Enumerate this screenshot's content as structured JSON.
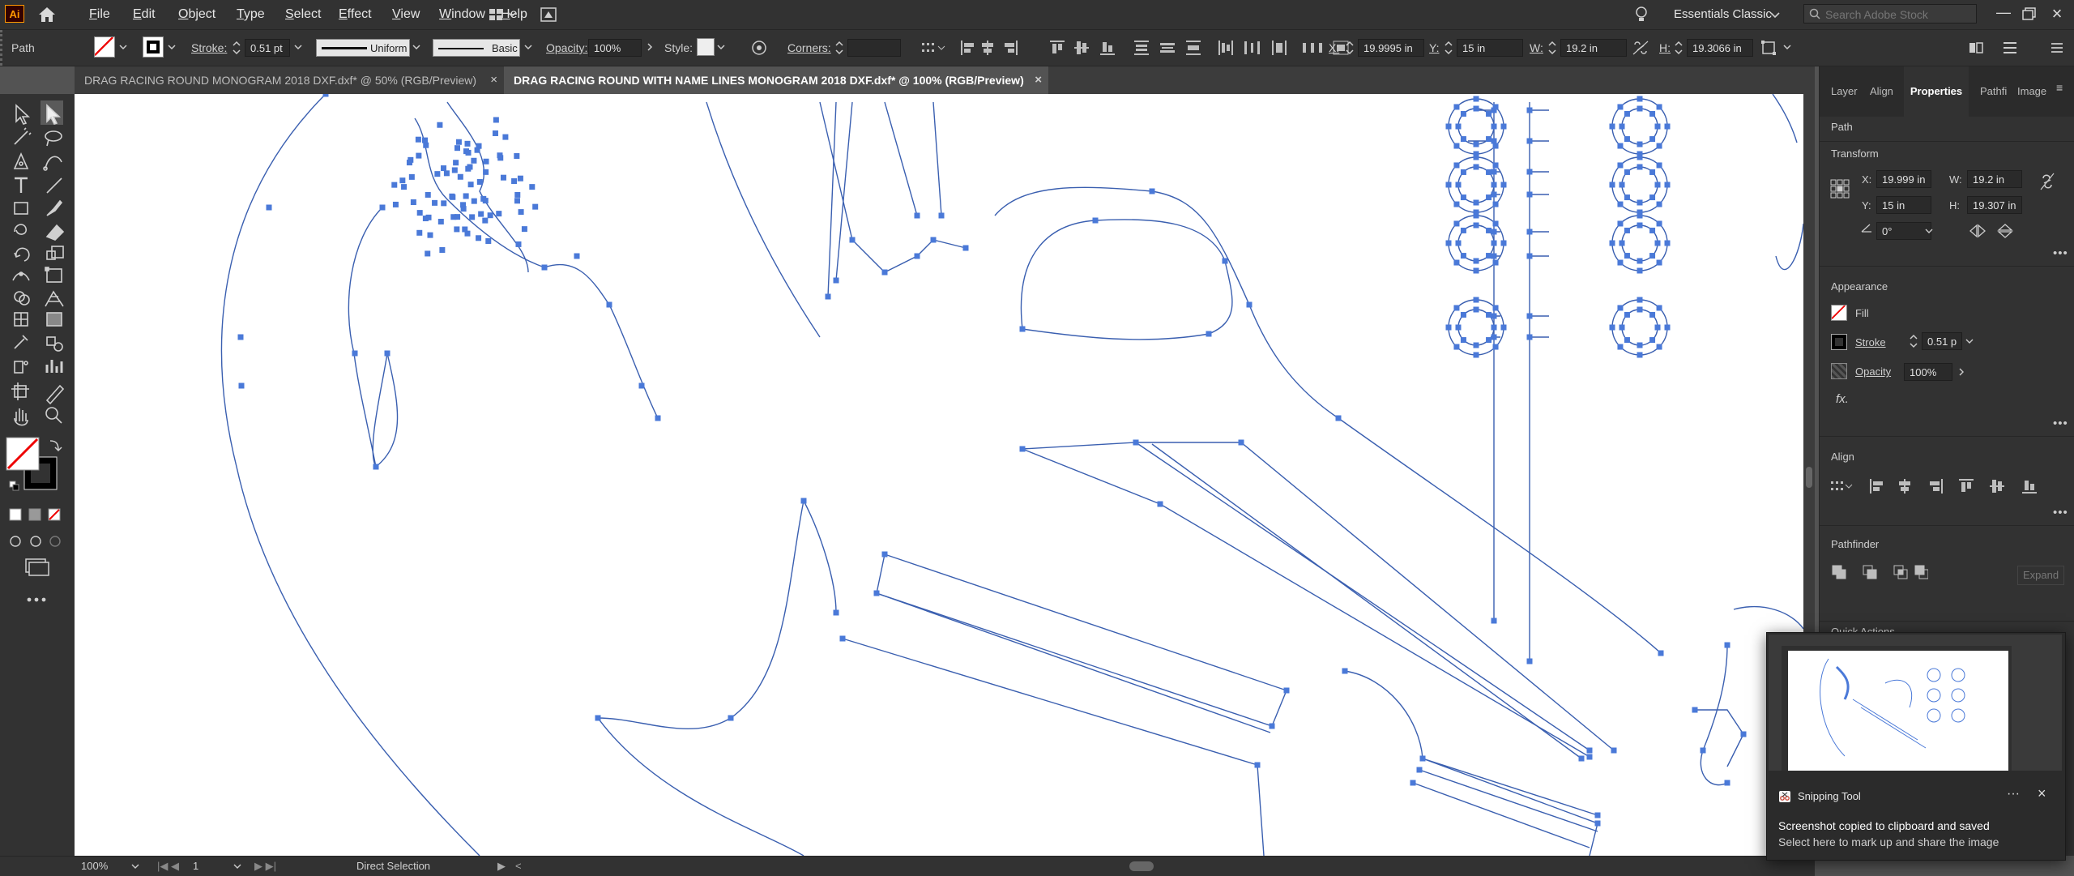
{
  "app": {
    "logo": "Ai"
  },
  "menu": {
    "items": [
      {
        "label": "File",
        "u": "F",
        "rest": "ile"
      },
      {
        "label": "Edit",
        "u": "E",
        "rest": "dit"
      },
      {
        "label": "Object",
        "u": "O",
        "rest": "bject"
      },
      {
        "label": "Type",
        "u": "T",
        "rest": "ype"
      },
      {
        "label": "Select",
        "u": "S",
        "rest": "elect"
      },
      {
        "label": "Effect",
        "u": "E",
        "rest": "ffect"
      },
      {
        "label": "View",
        "u": "V",
        "rest": "iew"
      },
      {
        "label": "Window",
        "u": "W",
        "rest": "indow"
      },
      {
        "label": "Help",
        "u": "H",
        "rest": "elp"
      }
    ],
    "workspace": "Essentials Classic",
    "search_placeholder": "Search Adobe Stock"
  },
  "control": {
    "object_type": "Path",
    "stroke_label": "Stroke:",
    "stroke_value": "0.51 pt",
    "profile_uniform": "Uniform",
    "brush_basic": "Basic",
    "opacity_label": "Opacity:",
    "opacity_value": "100%",
    "style_label": "Style:",
    "corners_label": "Corners:",
    "x_label": "X:",
    "x_value": "19.9995 in",
    "y_label": "Y:",
    "y_value": "15 in",
    "w_label": "W:",
    "w_value": "19.2 in",
    "h_label": "H:",
    "h_value": "19.3066 in"
  },
  "tabs": [
    {
      "label": "DRAG RACING ROUND MONOGRAM 2018 DXF.dxf* @ 50% (RGB/Preview)",
      "close": "×"
    },
    {
      "label": "DRAG RACING ROUND WITH NAME LINES MONOGRAM 2018 DXF.dxf* @ 100% (RGB/Preview)",
      "close": "×"
    }
  ],
  "panel": {
    "tabs": [
      "Layer",
      "Align",
      "Properties",
      "Pathfi",
      "Image"
    ],
    "selected_tab": "Properties",
    "object_type": "Path",
    "transform": {
      "title": "Transform",
      "x_label": "X:",
      "x_value": "19.999 in",
      "y_label": "Y:",
      "y_value": "15 in",
      "w_label": "W:",
      "w_value": "19.2 in",
      "h_label": "H:",
      "h_value": "19.307 in",
      "angle_value": "0°"
    },
    "appearance": {
      "title": "Appearance",
      "fill_label": "Fill",
      "stroke_label": "Stroke",
      "stroke_value": "0.51 p",
      "opacity_label": "Opacity",
      "opacity_value": "100%",
      "fx_label": "fx."
    },
    "align": {
      "title": "Align"
    },
    "pathfinder": {
      "title": "Pathfinder",
      "expand_label": "Expand"
    },
    "quick_actions": {
      "title": "Quick Actions"
    }
  },
  "status": {
    "zoom": "100%",
    "artboard": "1",
    "tool": "Direct Selection"
  },
  "toast": {
    "app_name": "Snipping Tool",
    "title": "Screenshot copied to clipboard and saved",
    "body": "Select here to mark up and share the image",
    "more": "···",
    "close": "×"
  },
  "colors": {
    "accent_path": "#4a79d8",
    "anchor": "#4a79d8",
    "ui_dark": "#323232",
    "canvas": "#ffffff"
  }
}
